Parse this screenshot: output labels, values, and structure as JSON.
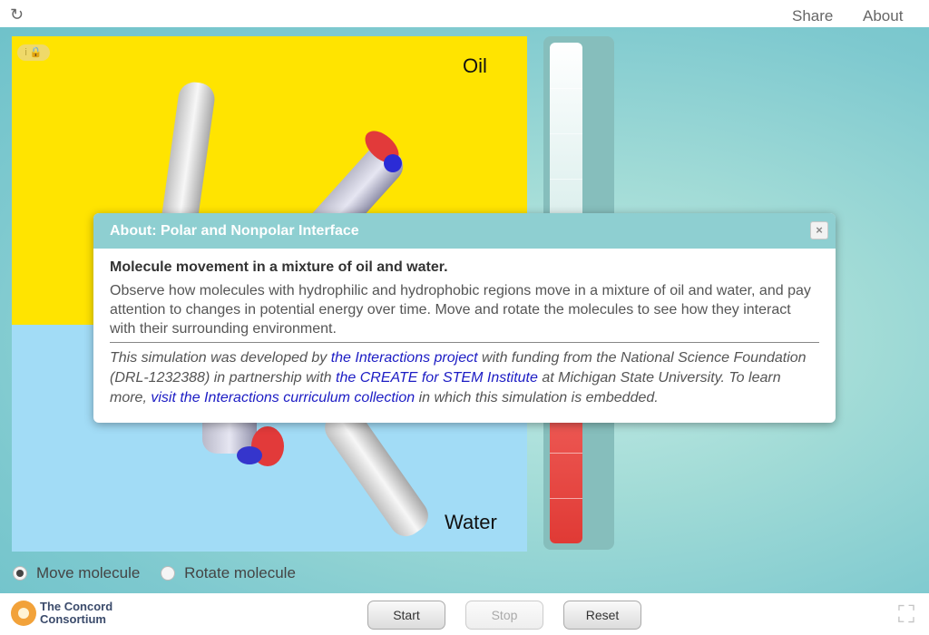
{
  "topbar": {
    "share": "Share",
    "about": "About",
    "reload_icon": "reload-icon"
  },
  "sim": {
    "oil_label": "Oil",
    "water_label": "Water",
    "info_icons": "i 🔒"
  },
  "thermometer": {
    "level": 0.27,
    "colors": {
      "fill": "#e03a35",
      "tube": "#dcefed"
    }
  },
  "controls": {
    "move": "Move molecule",
    "rotate": "Rotate molecule",
    "selected": "Move molecule",
    "start": "Start",
    "stop": "Stop",
    "reset": "Reset"
  },
  "logo": {
    "line1": "The Concord",
    "line2": "Consortium"
  },
  "dialog": {
    "title": "About: Polar and Nonpolar Interface",
    "close": "×",
    "subtitle": "Molecule movement in a mixture of oil and water.",
    "description": "Observe how molecules with hydrophilic and hydrophobic regions move in a mixture of oil and water, and pay attention to changes in potential energy over time. Move and rotate the molecules to see how they interact with their surrounding environment.",
    "credits": {
      "t1": "This simulation was developed by ",
      "l1": "the Interactions project",
      "t2": " with funding from the National Science Foundation (DRL-1232388) in partnership with ",
      "l2": "the CREATE for STEM Institute",
      "t3": " at Michigan State University. To learn more, ",
      "l3": "visit the Interactions curriculum collection",
      "t4": " in which this simulation is embedded."
    }
  },
  "colors": {
    "oil": "#ffe400",
    "water": "#a2dcf6",
    "dialog_header": "#8ecfd1",
    "link": "#1c1cc4"
  }
}
